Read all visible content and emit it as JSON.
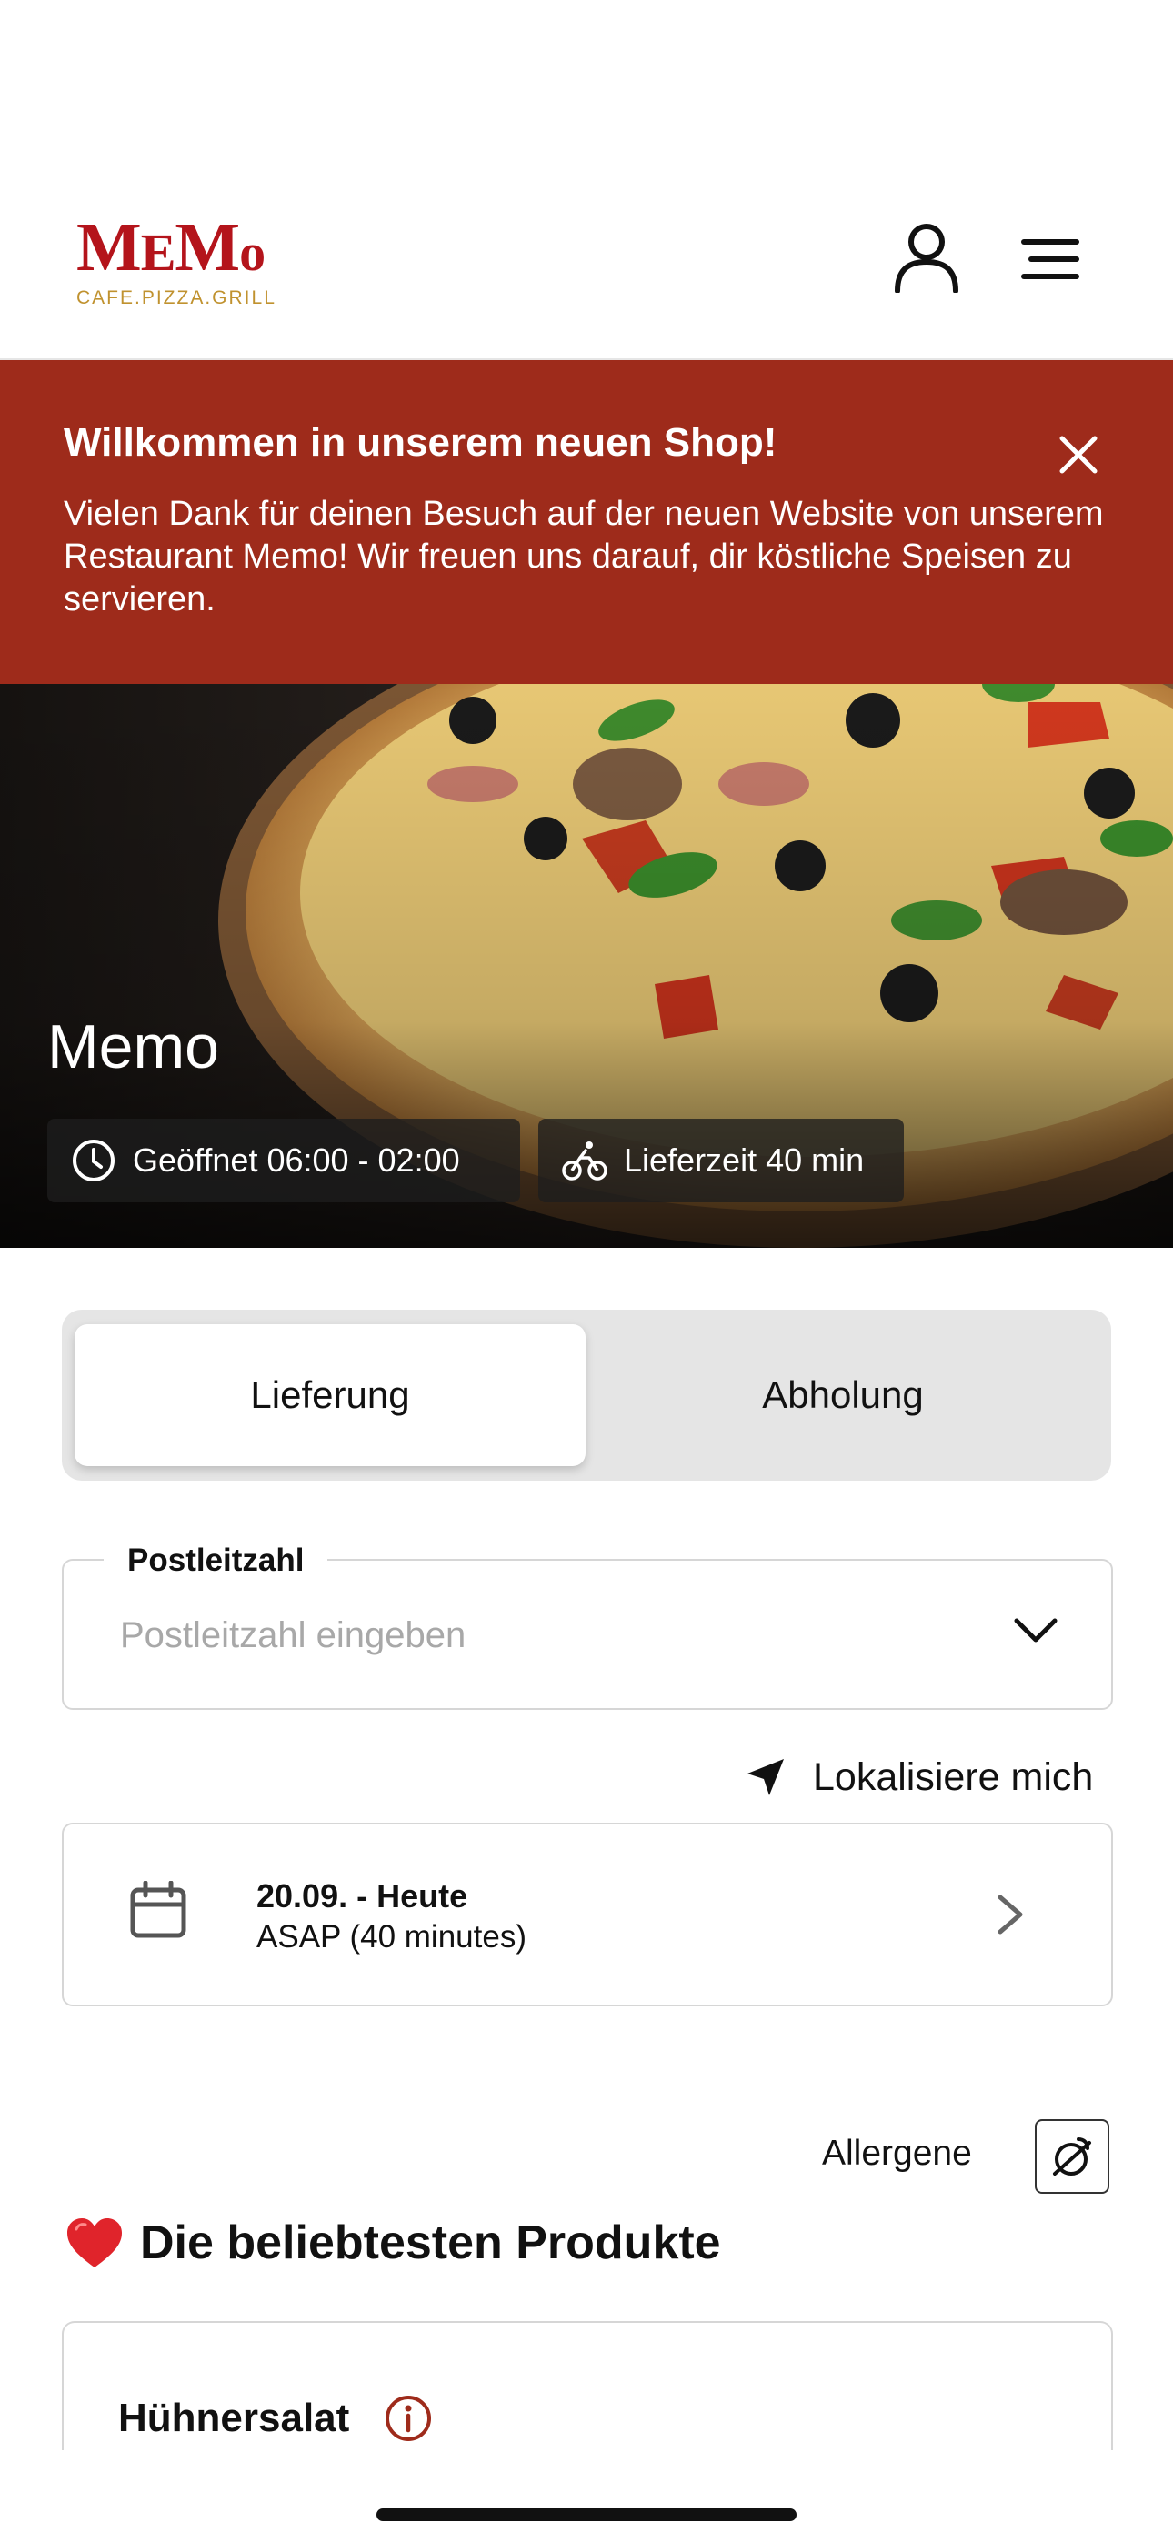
{
  "header": {
    "logo_main": "MEMO",
    "logo_sub": "CAFE.PIZZA.GRILL",
    "brand_color": "#b4141b",
    "icons": [
      "user-icon",
      "menu-icon"
    ]
  },
  "banner": {
    "title": "Willkommen in unserem neuen Shop!",
    "text": "Vielen Dank für deinen Besuch auf der neuen Website von unserem Restaurant Memo! Wir freuen uns darauf, dir köstliche Speisen zu servieren.",
    "color": "#9e2b1b"
  },
  "hero": {
    "title": "Memo",
    "open_hours": "Geöffnet 06:00 - 02:00",
    "delivery_time": "Lieferzeit 40 min"
  },
  "mode_toggle": {
    "options": [
      "Lieferung",
      "Abholung"
    ],
    "selected": "Lieferung"
  },
  "postcode": {
    "label": "Postleitzahl",
    "placeholder": "Postleitzahl eingeben",
    "value": ""
  },
  "locate": {
    "label": "Lokalisiere mich"
  },
  "date_selector": {
    "title": "20.09. - Heute",
    "subtitle": "ASAP (40 minutes)"
  },
  "allergene": {
    "label": "Allergene"
  },
  "popular": {
    "title": "Die beliebtesten Produkte",
    "products": [
      {
        "name": "Hühnersalat"
      }
    ]
  }
}
